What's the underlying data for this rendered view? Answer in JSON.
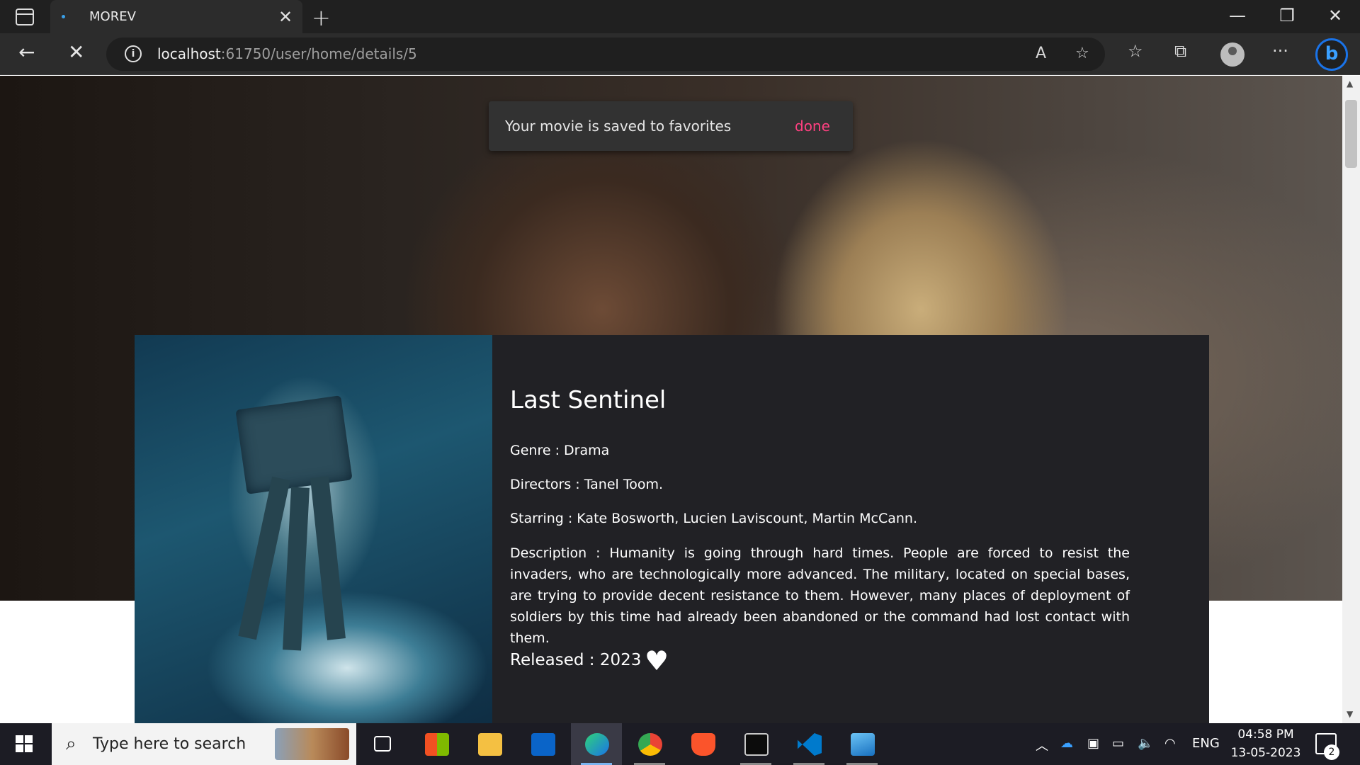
{
  "browser": {
    "tab_title": "MOREV",
    "url_host": "localhost",
    "url_rest": ":61750/user/home/details/5"
  },
  "toast": {
    "message": "Your movie is saved to favorites",
    "action": "done",
    "action_color": "#ff4081"
  },
  "movie": {
    "title": "Last Sentinel",
    "genre": "Genre : Drama",
    "directors": "Directors : Tanel Toom.",
    "starring": "Starring : Kate Bosworth, Lucien Laviscount, Martin McCann.",
    "description": "Description : Humanity is going through hard times. People are forced to resist the invaders, who are technologically more advanced. The military, located on special bases, are trying to provide decent resistance to them. However, many places of deployment of soldiers by this time had already been abandoned or the command had lost contact with them.",
    "released": "Released : 2023",
    "favorite_icon": "heart-icon"
  },
  "taskbar": {
    "search_placeholder": "Type here to search",
    "language": "ENG",
    "time": "04:58 PM",
    "date": "13-05-2023",
    "notification_count": "2"
  }
}
